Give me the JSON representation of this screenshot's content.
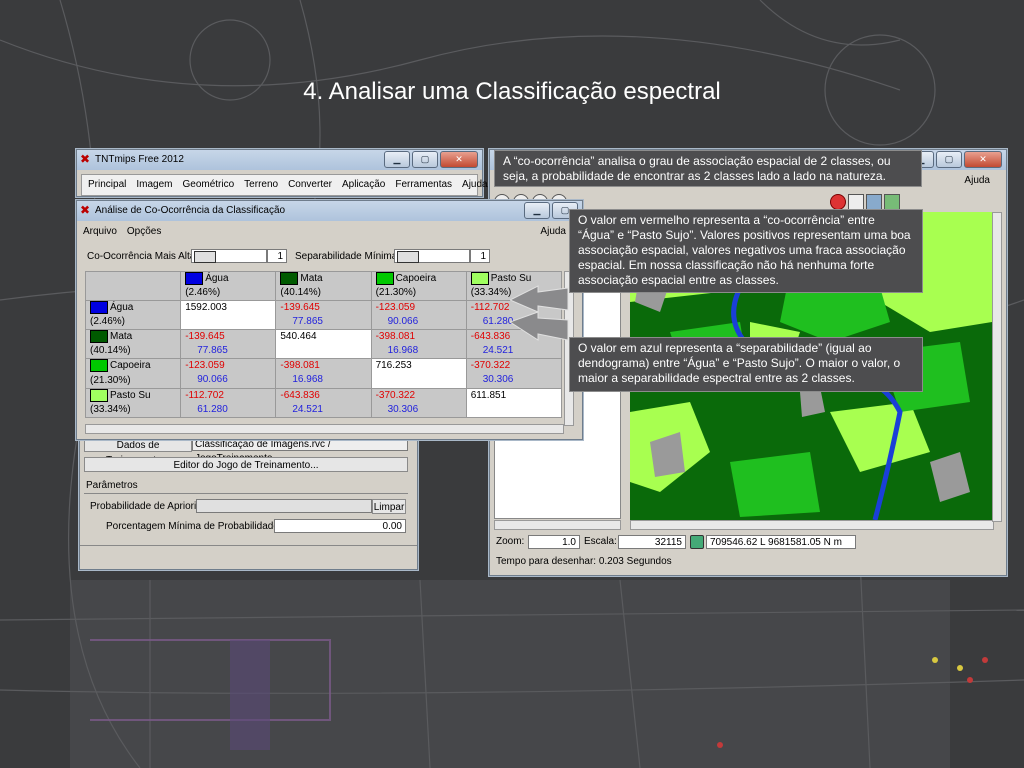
{
  "slide": {
    "title": "4. Analisar uma Classificação espectral"
  },
  "main_window": {
    "title": "TNTmips Free 2012",
    "menu": [
      "Principal",
      "Imagem",
      "Geométrico",
      "Terreno",
      "Converter",
      "Aplicação",
      "Ferramentas",
      "Ajuda"
    ]
  },
  "training_panel": {
    "dados_button": "Dados de Treinamento...",
    "dados_path": "Classificação de Imagens.rvc / JogoTreinamento",
    "editor_button": "Editor do Jogo de Treinamento...",
    "parametros_label": "Parâmetros",
    "prob_label": "Probabilidade de Apriori:",
    "limpar_button": "Limpar",
    "min_prob_label": "Porcentagem Mínima de Probabilidade:",
    "min_prob_value": "0.00"
  },
  "cooc_window": {
    "title": "Análise de Co-Ocorrência da Classificação",
    "menu": [
      "Arquivo",
      "Opções"
    ],
    "menu_right": "Ajuda",
    "cooc_label": "Co-Ocorrência Mais Alta:",
    "cooc_value": "1",
    "sep_label": "Separabilidade Mínima",
    "sep_value": "1",
    "classes": [
      {
        "name": "Água",
        "pct": "(2.46%)",
        "color": "#0000e0"
      },
      {
        "name": "Mata",
        "pct": "(40.14%)",
        "color": "#005a00"
      },
      {
        "name": "Capoeira",
        "pct": "(21.30%)",
        "color": "#00c800"
      },
      {
        "name": "Pasto Su",
        "pct": "(33.34%)",
        "color": "#a0ff60"
      }
    ],
    "rows": [
      {
        "cells": [
          {
            "top": "1592.003",
            "bottom": ""
          },
          {
            "top": "-139.645",
            "bottom": "77.865"
          },
          {
            "top": "-123.059",
            "bottom": "90.066"
          },
          {
            "top": "-112.702",
            "bottom": "61.280"
          }
        ]
      },
      {
        "cells": [
          {
            "top": "-139.645",
            "bottom": "77.865"
          },
          {
            "top": "540.464",
            "bottom": ""
          },
          {
            "top": "-398.081",
            "bottom": "16.968"
          },
          {
            "top": "-643.836",
            "bottom": "24.521"
          }
        ]
      },
      {
        "cells": [
          {
            "top": "-123.059",
            "bottom": "90.066"
          },
          {
            "top": "-398.081",
            "bottom": "16.968"
          },
          {
            "top": "716.253",
            "bottom": ""
          },
          {
            "top": "-370.322",
            "bottom": "30.306"
          }
        ]
      },
      {
        "cells": [
          {
            "top": "-112.702",
            "bottom": "61.280"
          },
          {
            "top": "-643.836",
            "bottom": "24.521"
          },
          {
            "top": "-370.322",
            "bottom": "30.306"
          },
          {
            "top": "611.851",
            "bottom": ""
          }
        ]
      }
    ]
  },
  "viewer_window": {
    "menu_right": "Ajuda",
    "zoom_label": "Zoom:",
    "zoom_value": "1.0",
    "scale_label": "Escala:",
    "scale_value": "32115",
    "coords": "709546.62 L  9681581.05 N m",
    "status": "Tempo para desenhar: 0.203 Segundos",
    "legend_colors": {
      "water": "#1a3fd8",
      "forest": "#0a6a0a",
      "capoeira": "#1fbf1f",
      "pasture": "#a8ff50",
      "bare": "#9a9a9a"
    }
  },
  "callouts": {
    "c1": "A “co-ocorrência” analisa o grau de associação espacial de 2 classes, ou seja, a probabilidade de encontrar as 2 classes lado a lado na natureza.",
    "c2": "O valor em vermelho representa a “co-ocorrência” entre “Água” e “Pasto Sujo”. Valores positivos representam uma boa associação espacial, valores negativos uma fraca associação espacial. Em nossa classificação não há nenhuma forte associação espacial entre as classes.",
    "c3": "O valor em azul representa a “separabilidade” (igual ao dendograma) entre “Água” e “Pasto Sujo”. O maior o valor, o maior a separabilidade espectral entre as 2 classes."
  }
}
